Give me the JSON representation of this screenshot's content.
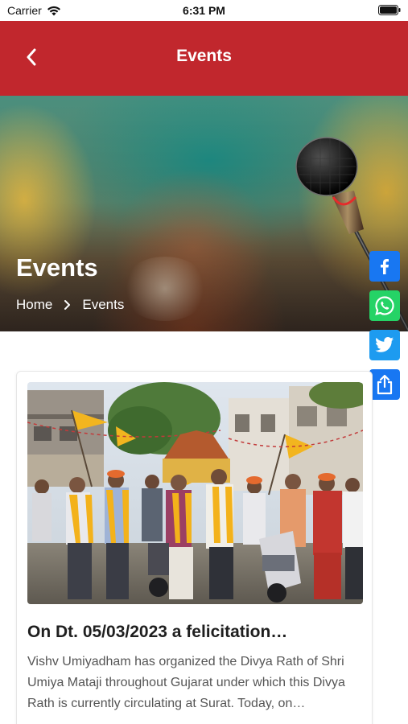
{
  "status_bar": {
    "carrier": "Carrier",
    "time": "6:31 PM"
  },
  "nav": {
    "title": "Events",
    "back_icon": "chevron-left-icon",
    "background": "#c1272d"
  },
  "hero": {
    "title": "Events",
    "breadcrumb": {
      "home": "Home",
      "separator_icon": "chevron-right-icon",
      "current": "Events"
    }
  },
  "share": [
    {
      "name": "facebook",
      "icon": "facebook-icon",
      "color": "#1877f2"
    },
    {
      "name": "whatsapp",
      "icon": "whatsapp-icon",
      "color": "#25d366"
    },
    {
      "name": "twitter",
      "icon": "twitter-icon",
      "color": "#1d9bf0"
    },
    {
      "name": "share",
      "icon": "share-icon",
      "color": "#1877f2"
    }
  ],
  "event": {
    "title": "On Dt. 05/03/2023 a felicitation…",
    "description": "Vishv Umiyadham has organized the Divya Rath of Shri Umiya Mataji throughout Gujarat under which this Divya Rath is currently circulating at Surat. Today, on…"
  }
}
